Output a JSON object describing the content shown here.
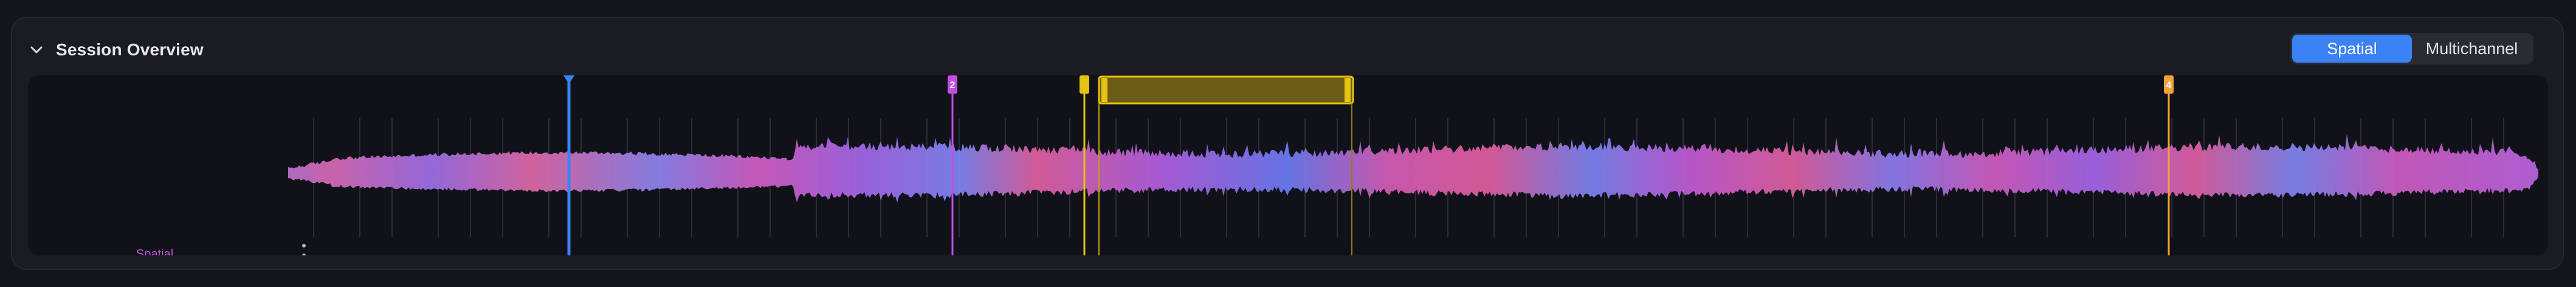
{
  "section": {
    "title": "Session Overview",
    "collapse_icon": "chevron-down-icon"
  },
  "view_toggle": {
    "options": [
      {
        "label": "Spatial",
        "active": true
      },
      {
        "label": "Multichannel",
        "active": false
      }
    ]
  },
  "track": {
    "label": "Spatial",
    "menu_icon": "vertical-dots-icon"
  },
  "markers": [
    {
      "label": "2",
      "color": "#c34ee3"
    },
    {
      "label": "",
      "color": "#e6c312"
    },
    {
      "label": "4",
      "color": "#f2a23a"
    }
  ],
  "selection": {
    "color": "#e6c312"
  },
  "playhead": {
    "color": "#3b82f6"
  },
  "colors": {
    "accent": "#3b82f6",
    "wave_blue": "#6f7ff0",
    "wave_pink": "#e05aa8",
    "wave_purple": "#a95fe6"
  }
}
